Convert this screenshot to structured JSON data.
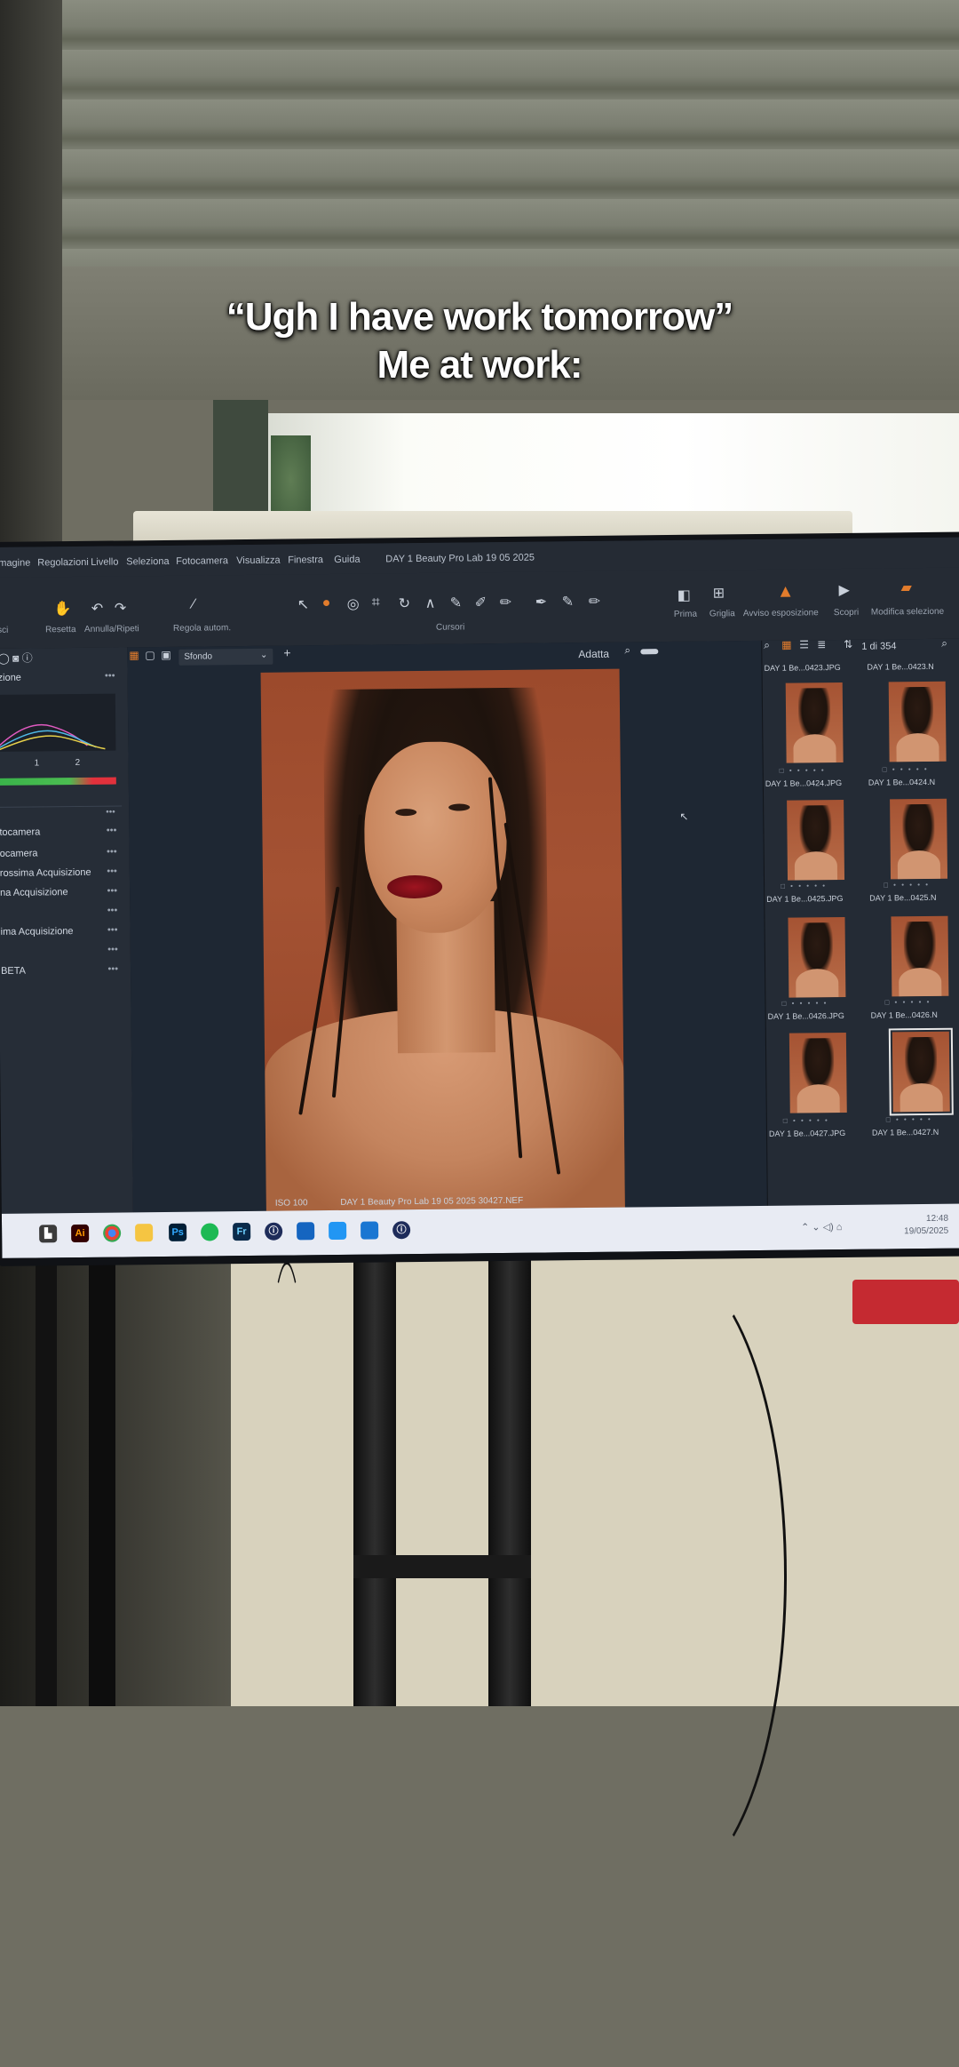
{
  "caption": {
    "line1": "“Ugh I have work tomorrow”",
    "line2": "Me at work:"
  },
  "app": {
    "menu": [
      "magine",
      "Regolazioni",
      "Livello",
      "Seleziona",
      "Fotocamera",
      "Visualizza",
      "Finestra",
      "Guida"
    ],
    "window_title": "DAY 1 Beauty Pro Lab 19 05 2025",
    "toolbar": {
      "left_label": "sci",
      "reset_label": "Resetta",
      "undo_label": "Annulla/Ripeti",
      "auto_label": "Regola autom.",
      "cursors_label": "Cursori",
      "right_buttons": [
        "Prima",
        "Griglia",
        "Avviso esposizione",
        "Scopri",
        "Modifica selezione"
      ]
    },
    "left_panel": {
      "section": "zione",
      "hist_ticks": [
        "1",
        "2"
      ],
      "rows": [
        "tocamera",
        "ocamera",
        "rossima Acquisizione",
        "na Acquisizione",
        "",
        "ima Acquisizione",
        "",
        "BETA"
      ]
    },
    "viewer": {
      "background_select": "Sfondo",
      "fit_label": "Adatta",
      "iso": "ISO 100",
      "filename": "DAY 1 Beauty Pro Lab 19 05 2025 30427.NEF"
    },
    "browser": {
      "count": "1 di 354",
      "rows": [
        {
          "a": "DAY 1 Be...0423.JPG",
          "b": "DAY 1 Be...0423.N"
        },
        {
          "a": "DAY 1 Be...0424.JPG",
          "b": "DAY 1 Be...0424.N"
        },
        {
          "a": "DAY 1 Be...0425.JPG",
          "b": "DAY 1 Be...0425.N"
        },
        {
          "a": "DAY 1 Be...0426.JPG",
          "b": "DAY 1 Be...0426.N"
        },
        {
          "a": "DAY 1 Be...0427.JPG",
          "b": "DAY 1 Be...0427.N"
        }
      ]
    },
    "taskbar": {
      "icons": [
        "Ai",
        "Ps",
        "Fr"
      ],
      "time": "12:48",
      "date": "19/05/2025"
    }
  },
  "colors": {
    "accent_orange": "#e27c2c",
    "app_bg": "#1d2531",
    "taskbar_bg": "#e8ebf3"
  }
}
